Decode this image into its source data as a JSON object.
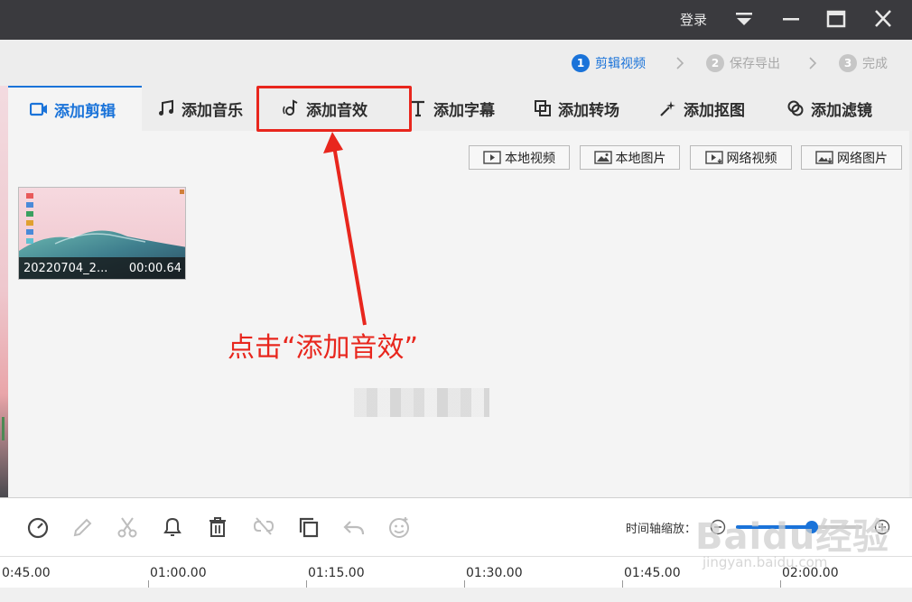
{
  "titlebar": {
    "login": "登录",
    "colors": {
      "bg": "#3a3a3e",
      "fg": "#e8e8e8"
    }
  },
  "steps": [
    {
      "num": "1",
      "label": "剪辑视频",
      "state": "active"
    },
    {
      "num": "2",
      "label": "保存导出",
      "state": "inactive"
    },
    {
      "num": "3",
      "label": "完成",
      "state": "inactive"
    }
  ],
  "tabs": [
    {
      "label": "添加剪辑",
      "icon": "video-camera-icon",
      "active": true
    },
    {
      "label": "添加音乐",
      "icon": "music-note-icon",
      "active": false
    },
    {
      "label": "添加音效",
      "icon": "sound-effect-icon",
      "active": false
    },
    {
      "label": "添加字幕",
      "icon": "text-icon",
      "active": false
    },
    {
      "label": "添加转场",
      "icon": "transition-icon",
      "active": false
    },
    {
      "label": "添加抠图",
      "icon": "cutout-icon",
      "active": false
    },
    {
      "label": "添加滤镜",
      "icon": "filter-icon",
      "active": false
    }
  ],
  "source_buttons": [
    {
      "label": "本地视频",
      "icon": "local-video-icon"
    },
    {
      "label": "本地图片",
      "icon": "local-image-icon"
    },
    {
      "label": "网络视频",
      "icon": "network-video-icon"
    },
    {
      "label": "网络图片",
      "icon": "network-image-icon"
    }
  ],
  "clip": {
    "name": "20220704_2...",
    "duration": "00:00.64"
  },
  "annotation": {
    "text": "点击“添加音效”",
    "color": "#e8261d"
  },
  "toolbar": {
    "tools": [
      "speed-icon",
      "edit-pencil-icon",
      "scissors-icon",
      "bell-icon",
      "trash-icon",
      "unlink-icon",
      "copy-icon",
      "undo-icon",
      "emoji-icon"
    ],
    "zoom_label": "时间轴缩放：",
    "zoom_level": 0.6
  },
  "timeline": {
    "ticks": [
      "0:45.00",
      "01:00.00",
      "01:15.00",
      "01:30.00",
      "01:45.00",
      "02:00.00"
    ]
  },
  "watermark": {
    "text": "Baidu经验",
    "sub": "jingyan.baidu.com"
  },
  "accent_color": "#1a73d9"
}
